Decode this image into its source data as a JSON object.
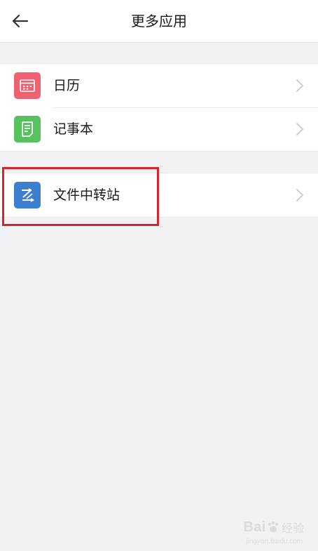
{
  "header": {
    "title": "更多应用",
    "back_icon": "arrow-left-icon"
  },
  "groups": [
    {
      "items": [
        {
          "label": "日历",
          "icon": "calendar-icon",
          "icon_color": "#ee6272"
        },
        {
          "label": "记事本",
          "icon": "notepad-icon",
          "icon_color": "#56c15e"
        }
      ]
    },
    {
      "items": [
        {
          "label": "文件中转站",
          "icon": "file-transfer-icon",
          "icon_color": "#3d7fcf"
        }
      ]
    }
  ],
  "annotation": {
    "highlight_color": "#d9232d"
  },
  "watermark": {
    "brand": "Bai",
    "text": "经验",
    "sub": "jingyan.baidu.com"
  }
}
